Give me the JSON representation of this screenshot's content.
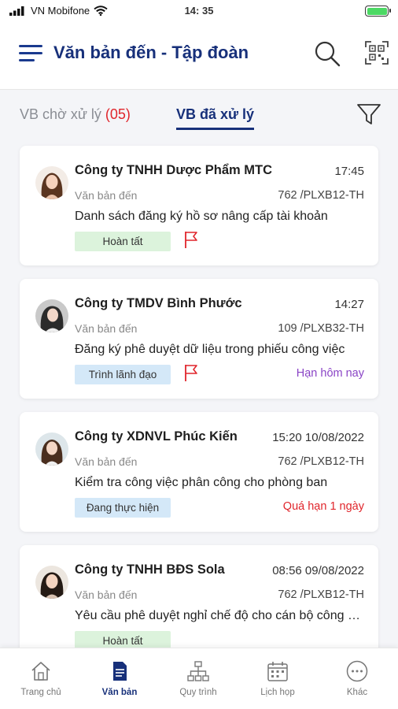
{
  "statusbar": {
    "carrier": "VN Mobifone",
    "time": "14: 35"
  },
  "header": {
    "title": "Văn bản đến - Tập đoàn"
  },
  "tabs": {
    "pending_label": "VB chờ xử lý ",
    "pending_count": "(05)",
    "processed_label": "VB đã xử lý"
  },
  "colors": {
    "primary": "#17307a",
    "danger": "#e0252b",
    "purple": "#8a44c6",
    "success_bg": "#dcf3dc",
    "info_bg": "#d4e8f8"
  },
  "items": [
    {
      "company": "Công ty TNHH Dược Phẩm MTC",
      "time": "17:45",
      "type": "Văn bản đến",
      "code": "762 /PLXB12-TH",
      "subject": "Danh sách đăng ký hồ sơ nâng cấp tài khoản",
      "status": "Hoàn tất",
      "flag": "red-flag-icon",
      "deadline": ""
    },
    {
      "company": "Công ty TMDV Bình Phước",
      "time": "14:27",
      "type": "Văn bản đến",
      "code": "109 /PLXB32-TH",
      "subject": "Đăng ký phê duyệt dữ liệu trong phiếu công việc",
      "status": "Trình lãnh đạo",
      "flag": "red-flag-icon",
      "deadline": "Hạn hôm nay"
    },
    {
      "company": "Công ty XDNVL Phúc Kiến",
      "time": "15:20 10/08/2022",
      "type": "Văn bản đến",
      "code": "762 /PLXB12-TH",
      "subject": "Kiểm tra công việc phân công cho phòng ban",
      "status": "Đang thực hiện",
      "flag": "",
      "deadline": "Quá hạn 1 ngày"
    },
    {
      "company": "Công ty TNHH BĐS Sola",
      "time": "08:56 09/08/2022",
      "type": "Văn bản đến",
      "code": "762 /PLXB12-TH",
      "subject": "Yêu cầu phê duyệt nghỉ chế độ cho cán bộ công nhân",
      "status": "Hoàn tất",
      "flag": "",
      "deadline": ""
    }
  ],
  "bottom_nav": [
    {
      "label": "Trang chủ",
      "icon": "home-icon"
    },
    {
      "label": "Văn bản",
      "icon": "document-icon"
    },
    {
      "label": "Quy trình",
      "icon": "workflow-icon"
    },
    {
      "label": "Lịch họp",
      "icon": "calendar-icon"
    },
    {
      "label": "Khác",
      "icon": "more-icon"
    }
  ]
}
